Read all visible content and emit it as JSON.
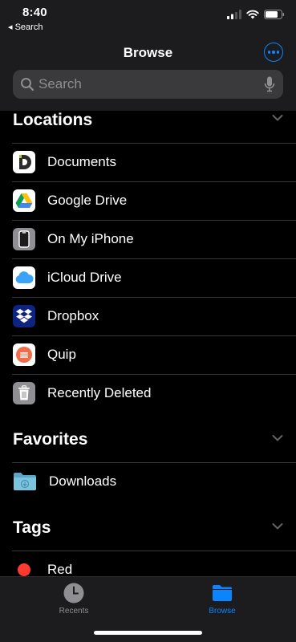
{
  "status_bar": {
    "time": "8:40",
    "back_app": "◂ Search"
  },
  "nav": {
    "title": "Browse",
    "more_icon": "ellipsis-circle-icon"
  },
  "search": {
    "placeholder": "Search",
    "value": ""
  },
  "sections": {
    "locations": {
      "title": "Locations",
      "items": [
        {
          "label": "Documents",
          "icon": "documents-app-icon"
        },
        {
          "label": "Google Drive",
          "icon": "google-drive-icon"
        },
        {
          "label": "On My iPhone",
          "icon": "iphone-icon"
        },
        {
          "label": "iCloud Drive",
          "icon": "icloud-icon"
        },
        {
          "label": "Dropbox",
          "icon": "dropbox-icon"
        },
        {
          "label": "Quip",
          "icon": "quip-icon"
        },
        {
          "label": "Recently Deleted",
          "icon": "trash-icon"
        }
      ]
    },
    "favorites": {
      "title": "Favorites",
      "items": [
        {
          "label": "Downloads",
          "icon": "downloads-folder-icon"
        }
      ]
    },
    "tags": {
      "title": "Tags",
      "items": [
        {
          "label": "Red",
          "icon": "red-tag-icon",
          "color": "#ff3b30"
        }
      ]
    }
  },
  "tab_bar": {
    "tabs": [
      {
        "label": "Recents",
        "icon": "clock-icon",
        "active": false
      },
      {
        "label": "Browse",
        "icon": "folder-icon",
        "active": true
      }
    ]
  },
  "colors": {
    "accent": "#0a84ff",
    "inactive": "#8e8e93",
    "bar_bg": "#1c1c1e"
  }
}
